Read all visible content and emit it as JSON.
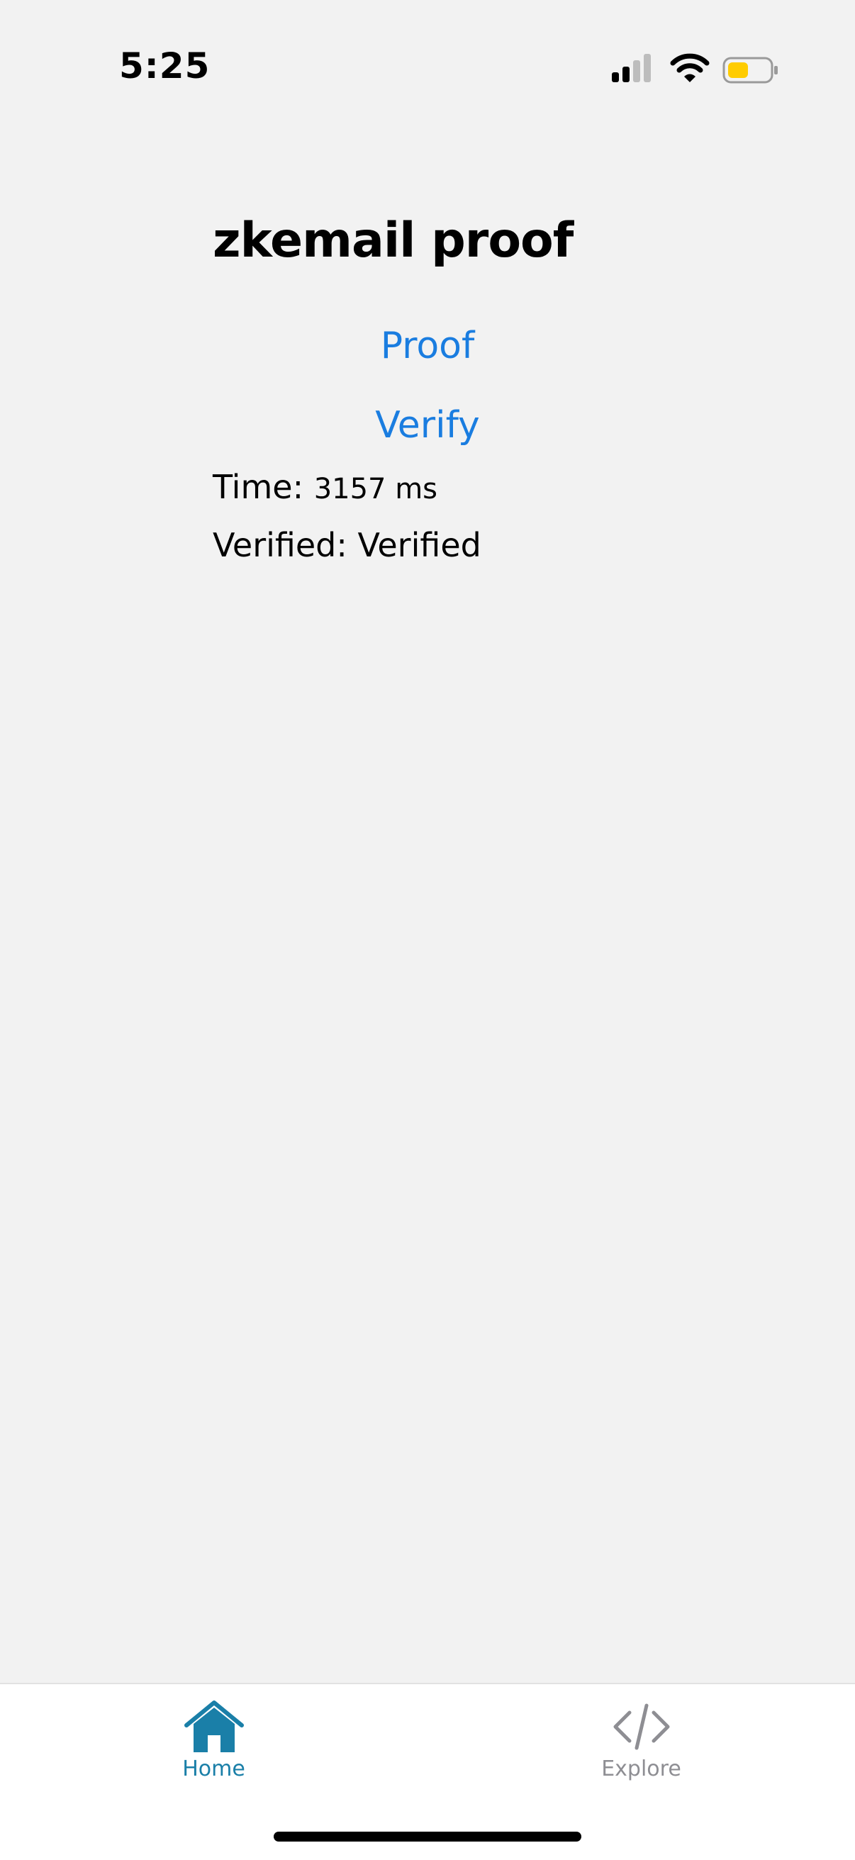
{
  "status_bar": {
    "time": "5:25",
    "battery_color": "#ffcc00",
    "icons": [
      "signal-icon",
      "wifi-icon",
      "battery-icon"
    ]
  },
  "main": {
    "title": "zkemail proof",
    "proof_label": "Proof",
    "verify_label": "Verify",
    "time_label": "Time: ",
    "time_value": "3157 ms",
    "verified_label": "Verified: ",
    "verified_value": "Verified",
    "link_color": "#1a7de0"
  },
  "tab_bar": {
    "tabs": [
      {
        "label": "Home",
        "icon": "home-icon",
        "active": true,
        "color": "#1a7fa8"
      },
      {
        "label": "Explore",
        "icon": "code-icon",
        "active": false,
        "color": "#8e8e93"
      }
    ]
  }
}
